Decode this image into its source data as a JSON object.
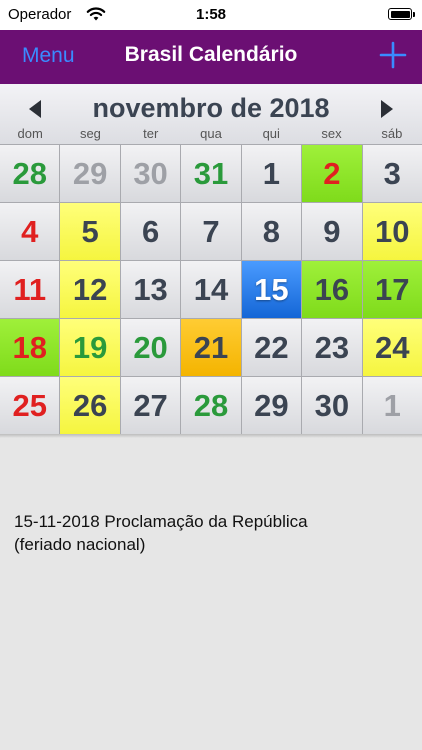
{
  "statusbar": {
    "carrier": "Operador",
    "time": "1:58"
  },
  "navbar": {
    "menu_label": "Menu",
    "title": "Brasil Calendário",
    "add_icon": "plus-icon"
  },
  "calendar": {
    "month_title": "novembro de 2018",
    "weekdays": [
      "dom",
      "seg",
      "ter",
      "qua",
      "qui",
      "sex",
      "sáb"
    ],
    "days": [
      {
        "n": "28",
        "cls": "holiday-green"
      },
      {
        "n": "29",
        "cls": "other"
      },
      {
        "n": "30",
        "cls": "other"
      },
      {
        "n": "31",
        "cls": "holiday-green"
      },
      {
        "n": "1",
        "cls": ""
      },
      {
        "n": "2",
        "cls": "bg-green red"
      },
      {
        "n": "3",
        "cls": ""
      },
      {
        "n": "4",
        "cls": "weekday-sun"
      },
      {
        "n": "5",
        "cls": "bg-yellow"
      },
      {
        "n": "6",
        "cls": ""
      },
      {
        "n": "7",
        "cls": ""
      },
      {
        "n": "8",
        "cls": ""
      },
      {
        "n": "9",
        "cls": ""
      },
      {
        "n": "10",
        "cls": "bg-yellow"
      },
      {
        "n": "11",
        "cls": "weekday-sun"
      },
      {
        "n": "12",
        "cls": "bg-yellow"
      },
      {
        "n": "13",
        "cls": ""
      },
      {
        "n": "14",
        "cls": ""
      },
      {
        "n": "15",
        "cls": "today"
      },
      {
        "n": "16",
        "cls": "bg-green"
      },
      {
        "n": "17",
        "cls": "bg-green"
      },
      {
        "n": "18",
        "cls": "bg-green red"
      },
      {
        "n": "19",
        "cls": "bg-yellow holiday-green"
      },
      {
        "n": "20",
        "cls": "holiday-green"
      },
      {
        "n": "21",
        "cls": "bg-orange"
      },
      {
        "n": "22",
        "cls": ""
      },
      {
        "n": "23",
        "cls": ""
      },
      {
        "n": "24",
        "cls": "bg-yellow"
      },
      {
        "n": "25",
        "cls": "weekday-sun"
      },
      {
        "n": "26",
        "cls": "bg-yellow"
      },
      {
        "n": "27",
        "cls": ""
      },
      {
        "n": "28",
        "cls": "holiday-green"
      },
      {
        "n": "29",
        "cls": ""
      },
      {
        "n": "30",
        "cls": ""
      },
      {
        "n": "1",
        "cls": "other"
      }
    ]
  },
  "events": {
    "line1": "15-11-2018 Proclamação da República",
    "line2": "(feriado nacional)"
  },
  "colors": {
    "nav_bg": "#6b0f73",
    "accent": "#3a8bff",
    "today": "#1466d6"
  }
}
